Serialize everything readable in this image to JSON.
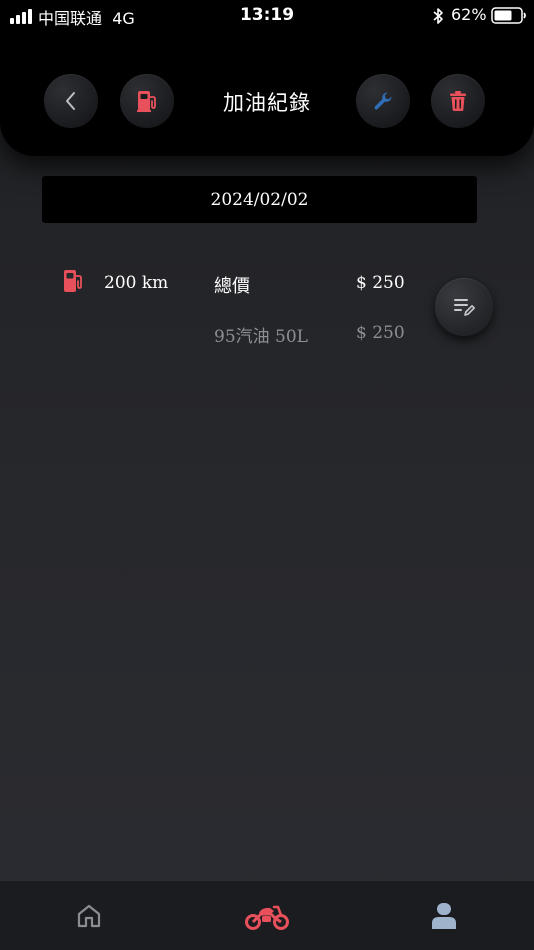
{
  "status_bar": {
    "carrier": "中国联通",
    "network": "4G",
    "time": "13:19",
    "battery_percent": "62%"
  },
  "header": {
    "title": "加油紀錄",
    "back_icon": "chevron-left-icon",
    "fuel_icon": "fuel-pump-icon",
    "wrench_icon": "wrench-icon",
    "trash_icon": "trash-icon"
  },
  "date": "2024/02/02",
  "record": {
    "mileage": "200 km",
    "total_label": "總價",
    "total_value": "$ 250",
    "items": [
      {
        "label": "95汽油 50L",
        "value": "$ 250"
      }
    ],
    "edit_icon": "edit-note-icon"
  },
  "tab_bar": {
    "tabs": [
      {
        "icon": "home-icon",
        "active": false
      },
      {
        "icon": "motorcycle-icon",
        "active": true
      },
      {
        "icon": "profile-icon",
        "active": false
      }
    ]
  },
  "colors": {
    "accent_red": "#e8505b",
    "wrench_blue": "#2e6fb8",
    "profile_blue": "#9fb3cc",
    "background": "#26272b",
    "header_bg": "#000000",
    "muted_text": "#8e8f93"
  }
}
